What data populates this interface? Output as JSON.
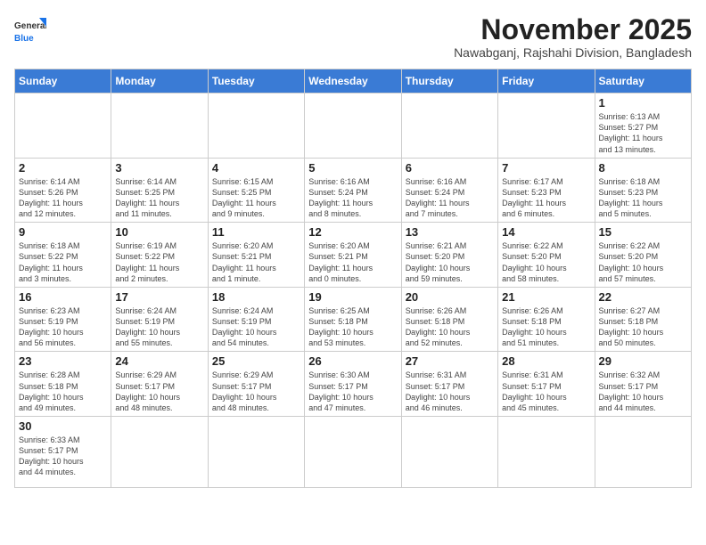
{
  "header": {
    "logo_general": "General",
    "logo_blue": "Blue",
    "month_title": "November 2025",
    "subtitle": "Nawabganj, Rajshahi Division, Bangladesh"
  },
  "weekdays": [
    "Sunday",
    "Monday",
    "Tuesday",
    "Wednesday",
    "Thursday",
    "Friday",
    "Saturday"
  ],
  "days": [
    {
      "date": null,
      "info": null
    },
    {
      "date": null,
      "info": null
    },
    {
      "date": null,
      "info": null
    },
    {
      "date": null,
      "info": null
    },
    {
      "date": null,
      "info": null
    },
    {
      "date": null,
      "info": null
    },
    {
      "date": "1",
      "info": "Sunrise: 6:13 AM\nSunset: 5:27 PM\nDaylight: 11 hours\nand 13 minutes."
    },
    {
      "date": "2",
      "info": "Sunrise: 6:14 AM\nSunset: 5:26 PM\nDaylight: 11 hours\nand 12 minutes."
    },
    {
      "date": "3",
      "info": "Sunrise: 6:14 AM\nSunset: 5:25 PM\nDaylight: 11 hours\nand 11 minutes."
    },
    {
      "date": "4",
      "info": "Sunrise: 6:15 AM\nSunset: 5:25 PM\nDaylight: 11 hours\nand 9 minutes."
    },
    {
      "date": "5",
      "info": "Sunrise: 6:16 AM\nSunset: 5:24 PM\nDaylight: 11 hours\nand 8 minutes."
    },
    {
      "date": "6",
      "info": "Sunrise: 6:16 AM\nSunset: 5:24 PM\nDaylight: 11 hours\nand 7 minutes."
    },
    {
      "date": "7",
      "info": "Sunrise: 6:17 AM\nSunset: 5:23 PM\nDaylight: 11 hours\nand 6 minutes."
    },
    {
      "date": "8",
      "info": "Sunrise: 6:18 AM\nSunset: 5:23 PM\nDaylight: 11 hours\nand 5 minutes."
    },
    {
      "date": "9",
      "info": "Sunrise: 6:18 AM\nSunset: 5:22 PM\nDaylight: 11 hours\nand 3 minutes."
    },
    {
      "date": "10",
      "info": "Sunrise: 6:19 AM\nSunset: 5:22 PM\nDaylight: 11 hours\nand 2 minutes."
    },
    {
      "date": "11",
      "info": "Sunrise: 6:20 AM\nSunset: 5:21 PM\nDaylight: 11 hours\nand 1 minute."
    },
    {
      "date": "12",
      "info": "Sunrise: 6:20 AM\nSunset: 5:21 PM\nDaylight: 11 hours\nand 0 minutes."
    },
    {
      "date": "13",
      "info": "Sunrise: 6:21 AM\nSunset: 5:20 PM\nDaylight: 10 hours\nand 59 minutes."
    },
    {
      "date": "14",
      "info": "Sunrise: 6:22 AM\nSunset: 5:20 PM\nDaylight: 10 hours\nand 58 minutes."
    },
    {
      "date": "15",
      "info": "Sunrise: 6:22 AM\nSunset: 5:20 PM\nDaylight: 10 hours\nand 57 minutes."
    },
    {
      "date": "16",
      "info": "Sunrise: 6:23 AM\nSunset: 5:19 PM\nDaylight: 10 hours\nand 56 minutes."
    },
    {
      "date": "17",
      "info": "Sunrise: 6:24 AM\nSunset: 5:19 PM\nDaylight: 10 hours\nand 55 minutes."
    },
    {
      "date": "18",
      "info": "Sunrise: 6:24 AM\nSunset: 5:19 PM\nDaylight: 10 hours\nand 54 minutes."
    },
    {
      "date": "19",
      "info": "Sunrise: 6:25 AM\nSunset: 5:18 PM\nDaylight: 10 hours\nand 53 minutes."
    },
    {
      "date": "20",
      "info": "Sunrise: 6:26 AM\nSunset: 5:18 PM\nDaylight: 10 hours\nand 52 minutes."
    },
    {
      "date": "21",
      "info": "Sunrise: 6:26 AM\nSunset: 5:18 PM\nDaylight: 10 hours\nand 51 minutes."
    },
    {
      "date": "22",
      "info": "Sunrise: 6:27 AM\nSunset: 5:18 PM\nDaylight: 10 hours\nand 50 minutes."
    },
    {
      "date": "23",
      "info": "Sunrise: 6:28 AM\nSunset: 5:18 PM\nDaylight: 10 hours\nand 49 minutes."
    },
    {
      "date": "24",
      "info": "Sunrise: 6:29 AM\nSunset: 5:17 PM\nDaylight: 10 hours\nand 48 minutes."
    },
    {
      "date": "25",
      "info": "Sunrise: 6:29 AM\nSunset: 5:17 PM\nDaylight: 10 hours\nand 48 minutes."
    },
    {
      "date": "26",
      "info": "Sunrise: 6:30 AM\nSunset: 5:17 PM\nDaylight: 10 hours\nand 47 minutes."
    },
    {
      "date": "27",
      "info": "Sunrise: 6:31 AM\nSunset: 5:17 PM\nDaylight: 10 hours\nand 46 minutes."
    },
    {
      "date": "28",
      "info": "Sunrise: 6:31 AM\nSunset: 5:17 PM\nDaylight: 10 hours\nand 45 minutes."
    },
    {
      "date": "29",
      "info": "Sunrise: 6:32 AM\nSunset: 5:17 PM\nDaylight: 10 hours\nand 44 minutes."
    },
    {
      "date": "30",
      "info": "Sunrise: 6:33 AM\nSunset: 5:17 PM\nDaylight: 10 hours\nand 44 minutes."
    },
    {
      "date": null,
      "info": null
    },
    {
      "date": null,
      "info": null
    },
    {
      "date": null,
      "info": null
    },
    {
      "date": null,
      "info": null
    },
    {
      "date": null,
      "info": null
    },
    {
      "date": null,
      "info": null
    }
  ]
}
